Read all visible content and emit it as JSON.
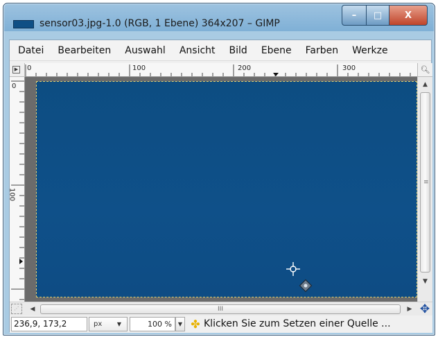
{
  "window": {
    "title": "sensor03.jpg-1.0 (RGB, 1 Ebene) 364x207 – GIMP",
    "minimize_label": "–",
    "maximize_label": "□",
    "close_label": "X"
  },
  "menubar": {
    "items": [
      {
        "label": "Datei"
      },
      {
        "label": "Bearbeiten"
      },
      {
        "label": "Auswahl"
      },
      {
        "label": "Ansicht"
      },
      {
        "label": "Bild"
      },
      {
        "label": "Ebene"
      },
      {
        "label": "Farben"
      },
      {
        "label": "Werkze"
      }
    ]
  },
  "ruler": {
    "h_labels": [
      "0",
      "100",
      "200",
      "300"
    ],
    "v_labels": [
      "0",
      "100"
    ]
  },
  "canvas": {
    "image_color": "#0e4e86",
    "selection_border_color": "#e0d070",
    "cursor_icon": "clone-cursor-icon"
  },
  "scrollbar": {
    "hthumb_label": "III"
  },
  "statusbar": {
    "coords": "236,9, 173,2",
    "unit": "px",
    "zoom": "100 %",
    "message": "Klicken Sie zum Setzen einer Quelle ..."
  },
  "colors": {
    "title_blue": "#0f4f85",
    "close_red": "#c0442a",
    "nav_blue": "#1f4fa0"
  }
}
